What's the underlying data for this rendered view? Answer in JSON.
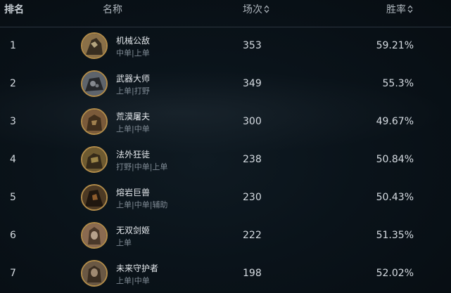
{
  "header": {
    "rank": "排名",
    "name": "名称",
    "games": "场次",
    "winrate": "胜率"
  },
  "rows": [
    {
      "rank": "1",
      "name": "机械公敌",
      "roles": "中单|上单",
      "games": "353",
      "winrate": "59.21%",
      "avatar_color": "#8a7048"
    },
    {
      "rank": "2",
      "name": "武器大师",
      "roles": "上单|打野",
      "games": "349",
      "winrate": "55.3%",
      "avatar_color": "#5e646c"
    },
    {
      "rank": "3",
      "name": "荒漠屠夫",
      "roles": "上单|中单",
      "games": "300",
      "winrate": "49.67%",
      "avatar_color": "#7a5a3a"
    },
    {
      "rank": "4",
      "name": "法外狂徒",
      "roles": "打野|中单|上单",
      "games": "238",
      "winrate": "50.84%",
      "avatar_color": "#6e5a30"
    },
    {
      "rank": "5",
      "name": "熔岩巨兽",
      "roles": "上单|中单|辅助",
      "games": "230",
      "winrate": "50.43%",
      "avatar_color": "#4d3a24"
    },
    {
      "rank": "6",
      "name": "无双剑姬",
      "roles": "上单",
      "games": "222",
      "winrate": "51.35%",
      "avatar_color": "#8a6a50"
    },
    {
      "rank": "7",
      "name": "未来守护者",
      "roles": "上单|中单",
      "games": "198",
      "winrate": "52.02%",
      "avatar_color": "#6a5844"
    }
  ],
  "colors": {
    "accent_border": "#b28c4a",
    "background": "#0a131a",
    "text": "#d6dce2",
    "subtext": "#7f8a94"
  },
  "icons": {
    "sort": "sort-updown-icon"
  }
}
